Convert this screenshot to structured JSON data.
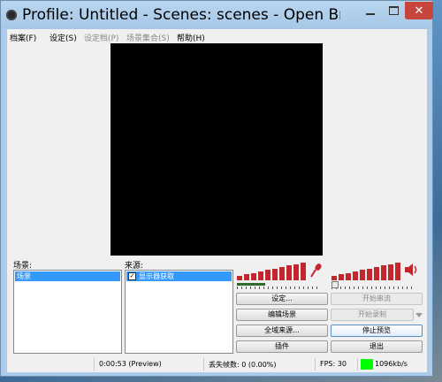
{
  "window": {
    "title": "Profile: Untitled - Scenes: scenes - Open Broadcast..."
  },
  "menu": {
    "items": [
      {
        "label": "档案(F)",
        "disabled": false
      },
      {
        "label": "设定(S)",
        "disabled": false
      },
      {
        "label": "设定档(P)",
        "disabled": true
      },
      {
        "label": "场景集合(S)",
        "disabled": true
      },
      {
        "label": "帮助(H)",
        "disabled": false
      }
    ]
  },
  "scenes": {
    "label": "场景:",
    "items": [
      "场景"
    ],
    "selected": "场景"
  },
  "sources": {
    "label": "来源:",
    "items": [
      {
        "label": "显示器获取",
        "checked": true
      }
    ],
    "selected": "显示器获取"
  },
  "audio": {
    "mic_levels": [
      3,
      4,
      5,
      6,
      7,
      8,
      9,
      10,
      11,
      12
    ],
    "desktop_levels": [
      3,
      4,
      5,
      6,
      7,
      8,
      9,
      10,
      11,
      12
    ],
    "mic_icon": "microphone-icon",
    "speaker_icon": "speaker-icon",
    "meter_color": "#c1272d"
  },
  "buttons": {
    "settings": "设定...",
    "start_stream": "开始串流",
    "edit_scene": "编辑场景",
    "start_record": "开始录制",
    "global_sources": "全域来源...",
    "stop_preview": "停止预览",
    "plugins": "插件",
    "exit": "退出"
  },
  "status": {
    "time": "0:00:53 (Preview)",
    "dropped_frames": "丢失帧数: 0 (0.00%)",
    "fps": "FPS: 30",
    "bitrate": "1096kb/s",
    "bitrate_color": "#00ff00"
  }
}
